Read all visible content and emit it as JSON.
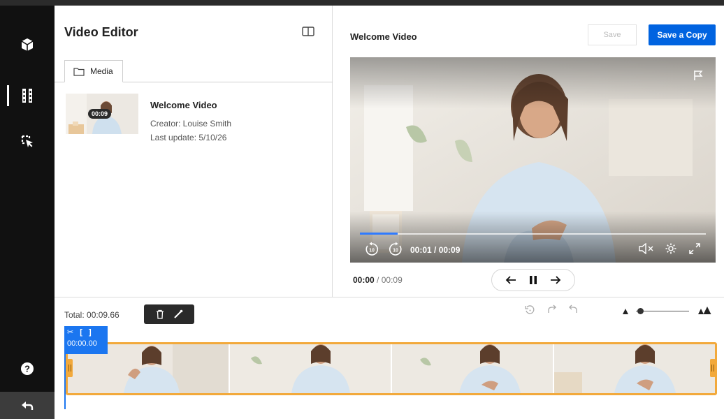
{
  "sidebar": {
    "items": [
      {
        "icon": "cube-icon"
      },
      {
        "icon": "film-strip-icon",
        "active": true
      },
      {
        "icon": "cursor-select-icon"
      }
    ],
    "help_icon": "help-icon",
    "back_icon": "back-arrow-icon"
  },
  "left_panel": {
    "title": "Video Editor",
    "tab_label": "Media",
    "media": {
      "thumb_duration": "00:09",
      "title": "Welcome Video",
      "creator": "Creator: Louise Smith",
      "updated": "Last update: 5/10/26"
    }
  },
  "right_panel": {
    "title": "Welcome Video",
    "save_label": "Save",
    "save_copy_label": "Save a Copy",
    "player": {
      "time_display": "00:01 / 00:09",
      "progress_fraction": 0.11
    },
    "current_time": "00:00",
    "time_separator": "/",
    "total_time": "00:09"
  },
  "timeline": {
    "total_label": "Total: 00:09.66",
    "trim_time": "00:00.00",
    "frame_count": 4
  },
  "colors": {
    "accent": "#0063e0",
    "sidebar": "#111111",
    "track_border": "#f2a93b",
    "playhead": "#1b76f0"
  }
}
